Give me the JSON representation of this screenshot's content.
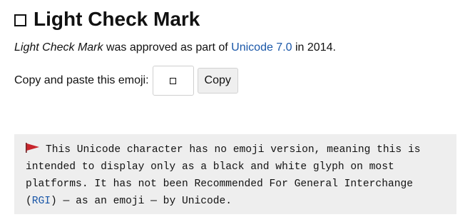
{
  "title": "Light Check Mark",
  "intro": {
    "name": "Light Check Mark",
    "mid": " was approved as part of ",
    "link": "Unicode 7.0",
    "end": " in 2014."
  },
  "copy_row": {
    "label": "Copy and paste this emoji:",
    "emoji": "🗸",
    "button_label": "Copy"
  },
  "notice": {
    "icon": "red-flag-icon",
    "text_before": "This Unicode character has no emoji version, meaning this is intended to display only as a black and white glyph on most platforms. It has not been Recommended For General Interchange (",
    "link": "RGI",
    "text_after": ") — as an emoji — by Unicode."
  },
  "colors": {
    "link": "#1a57a8",
    "notice_bg": "#eeeeee",
    "flag": "#c8252c"
  }
}
